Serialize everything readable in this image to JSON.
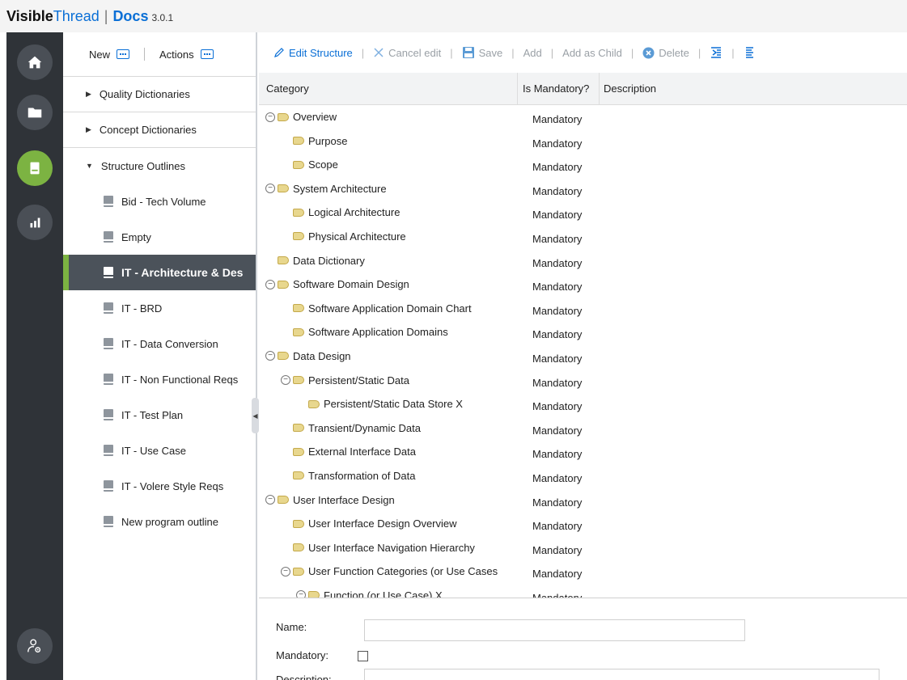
{
  "header": {
    "brand_bold": "Visible",
    "brand_light": "Thread",
    "separator": "|",
    "product": "Docs",
    "version": "3.0.1"
  },
  "rail": {
    "items": [
      "home-icon",
      "folder-icon",
      "document-icon",
      "chart-icon",
      "user-settings-icon"
    ],
    "active_color": "#7cb342"
  },
  "nav": {
    "new_label": "New",
    "actions_label": "Actions",
    "groups": [
      {
        "label": "Quality Dictionaries"
      },
      {
        "label": "Concept Dictionaries"
      },
      {
        "label": "Structure Outlines"
      }
    ],
    "items": [
      {
        "label": "Bid - Tech Volume"
      },
      {
        "label": "Empty"
      },
      {
        "label": "IT - Architecture & Des"
      },
      {
        "label": "IT - BRD"
      },
      {
        "label": "IT - Data Conversion"
      },
      {
        "label": "IT - Non Functional Reqs"
      },
      {
        "label": "IT - Test Plan"
      },
      {
        "label": "IT - Use Case"
      },
      {
        "label": "IT - Volere Style Reqs"
      },
      {
        "label": "New program outline"
      }
    ]
  },
  "toolbar": {
    "edit_structure": "Edit Structure",
    "cancel_edit": "Cancel edit",
    "save": "Save",
    "add": "Add",
    "add_as_child": "Add as Child",
    "delete": "Delete"
  },
  "grid": {
    "columns": {
      "category": "Category",
      "mandatory": "Is Mandatory?",
      "description": "Description"
    },
    "rows": [
      {
        "label": "Overview",
        "level": 0,
        "collapsible": true,
        "mandatory": "Mandatory"
      },
      {
        "label": "Purpose",
        "level": 1,
        "collapsible": false,
        "mandatory": "Mandatory"
      },
      {
        "label": "Scope",
        "level": 1,
        "collapsible": false,
        "mandatory": "Mandatory"
      },
      {
        "label": "System Architecture",
        "level": 0,
        "collapsible": true,
        "mandatory": "Mandatory"
      },
      {
        "label": "Logical Architecture",
        "level": 1,
        "collapsible": false,
        "mandatory": "Mandatory"
      },
      {
        "label": "Physical Architecture",
        "level": 1,
        "collapsible": false,
        "mandatory": "Mandatory"
      },
      {
        "label": "Data Dictionary",
        "level": 0,
        "collapsible": false,
        "mandatory": "Mandatory"
      },
      {
        "label": "Software Domain Design",
        "level": 0,
        "collapsible": true,
        "mandatory": "Mandatory"
      },
      {
        "label": "Software Application Domain Chart",
        "level": 1,
        "collapsible": false,
        "mandatory": "Mandatory"
      },
      {
        "label": "Software Application Domains",
        "level": 1,
        "collapsible": false,
        "mandatory": "Mandatory"
      },
      {
        "label": "Data Design",
        "level": 0,
        "collapsible": true,
        "mandatory": "Mandatory"
      },
      {
        "label": "Persistent/Static Data",
        "level": 1,
        "collapsible": true,
        "mandatory": "Mandatory"
      },
      {
        "label": "Persistent/Static Data Store X",
        "level": 2,
        "collapsible": false,
        "mandatory": "Mandatory"
      },
      {
        "label": "Transient/Dynamic Data",
        "level": 1,
        "collapsible": false,
        "mandatory": "Mandatory"
      },
      {
        "label": "External Interface Data",
        "level": 1,
        "collapsible": false,
        "mandatory": "Mandatory"
      },
      {
        "label": "Transformation of Data",
        "level": 1,
        "collapsible": false,
        "mandatory": "Mandatory"
      },
      {
        "label": "User Interface Design",
        "level": 0,
        "collapsible": true,
        "mandatory": "Mandatory"
      },
      {
        "label": "User Interface Design Overview",
        "level": 1,
        "collapsible": false,
        "mandatory": "Mandatory"
      },
      {
        "label": "User Interface Navigation Hierarchy",
        "level": 1,
        "collapsible": false,
        "mandatory": "Mandatory"
      },
      {
        "label": "User Function Categories (or Use Cases",
        "level": 1,
        "collapsible": true,
        "mandatory": "Mandatory"
      },
      {
        "label": "Function (or Use Case) X",
        "level": 2,
        "collapsible": true,
        "mandatory": "Mandatory"
      }
    ]
  },
  "form": {
    "name_label": "Name:",
    "name_value": "",
    "mandatory_label": "Mandatory:",
    "description_label": "Description:"
  }
}
